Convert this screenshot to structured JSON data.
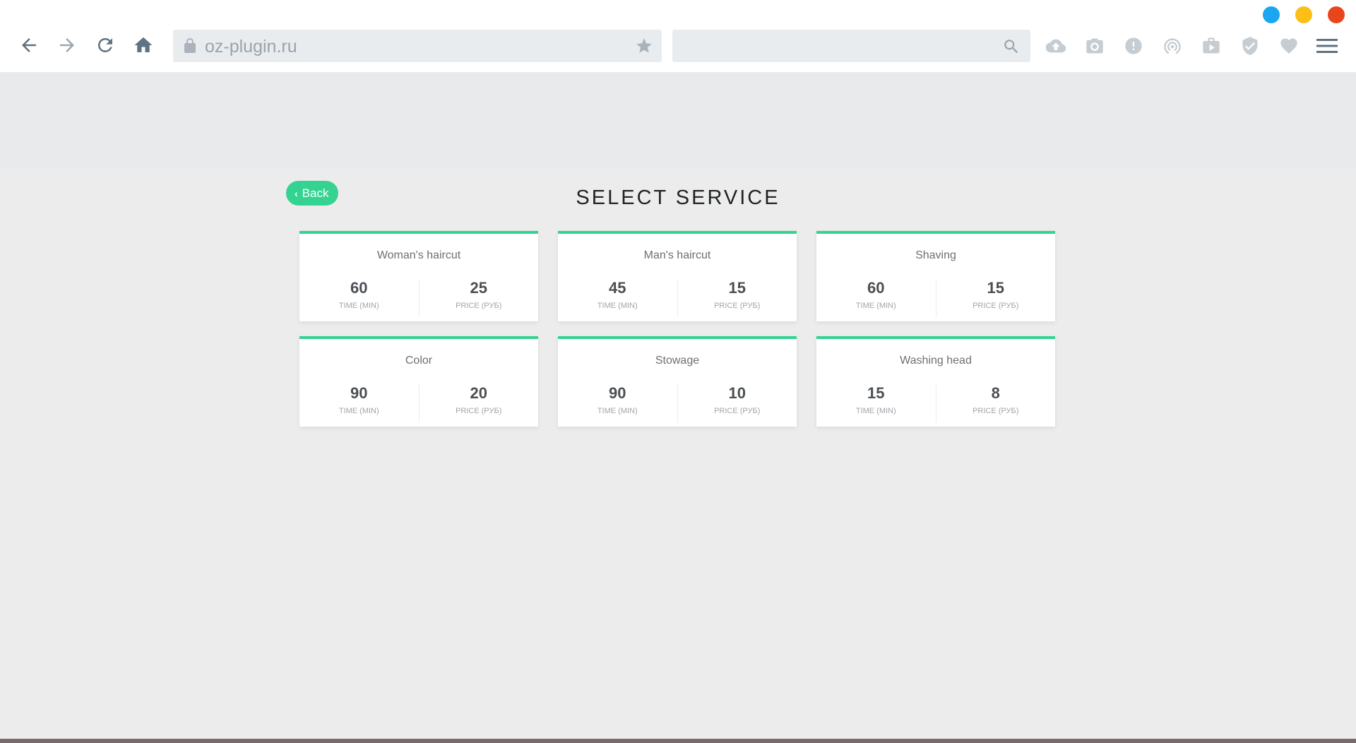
{
  "browser": {
    "url": "oz-plugin.ru",
    "search": {
      "value": "",
      "placeholder": ""
    },
    "window_controls": [
      {
        "name": "minimize",
        "color": "#1aa7f0"
      },
      {
        "name": "maximize",
        "color": "#fbbf16"
      },
      {
        "name": "close",
        "color": "#e8461a"
      }
    ],
    "nav_icons": [
      "back-arrow-icon",
      "forward-arrow-icon",
      "reload-icon",
      "home-icon"
    ],
    "toolbar_icons": [
      "cloud-upload-icon",
      "camera-icon",
      "alert-icon",
      "broadcast-icon",
      "video-case-icon",
      "shield-check-icon",
      "heart-icon",
      "menu-icon"
    ]
  },
  "page": {
    "back_label": "Back",
    "title": "SELECT SERVICE",
    "accent_color": "#34d391",
    "time_label": "TIME (MIN)",
    "price_label": "PRICE (РУБ)",
    "services": [
      {
        "name": "Woman's haircut",
        "time": "60",
        "price": "25"
      },
      {
        "name": "Man's haircut",
        "time": "45",
        "price": "15"
      },
      {
        "name": "Shaving",
        "time": "60",
        "price": "15"
      },
      {
        "name": "Color",
        "time": "90",
        "price": "20"
      },
      {
        "name": "Stowage",
        "time": "90",
        "price": "10"
      },
      {
        "name": "Washing head",
        "time": "15",
        "price": "8"
      }
    ]
  }
}
